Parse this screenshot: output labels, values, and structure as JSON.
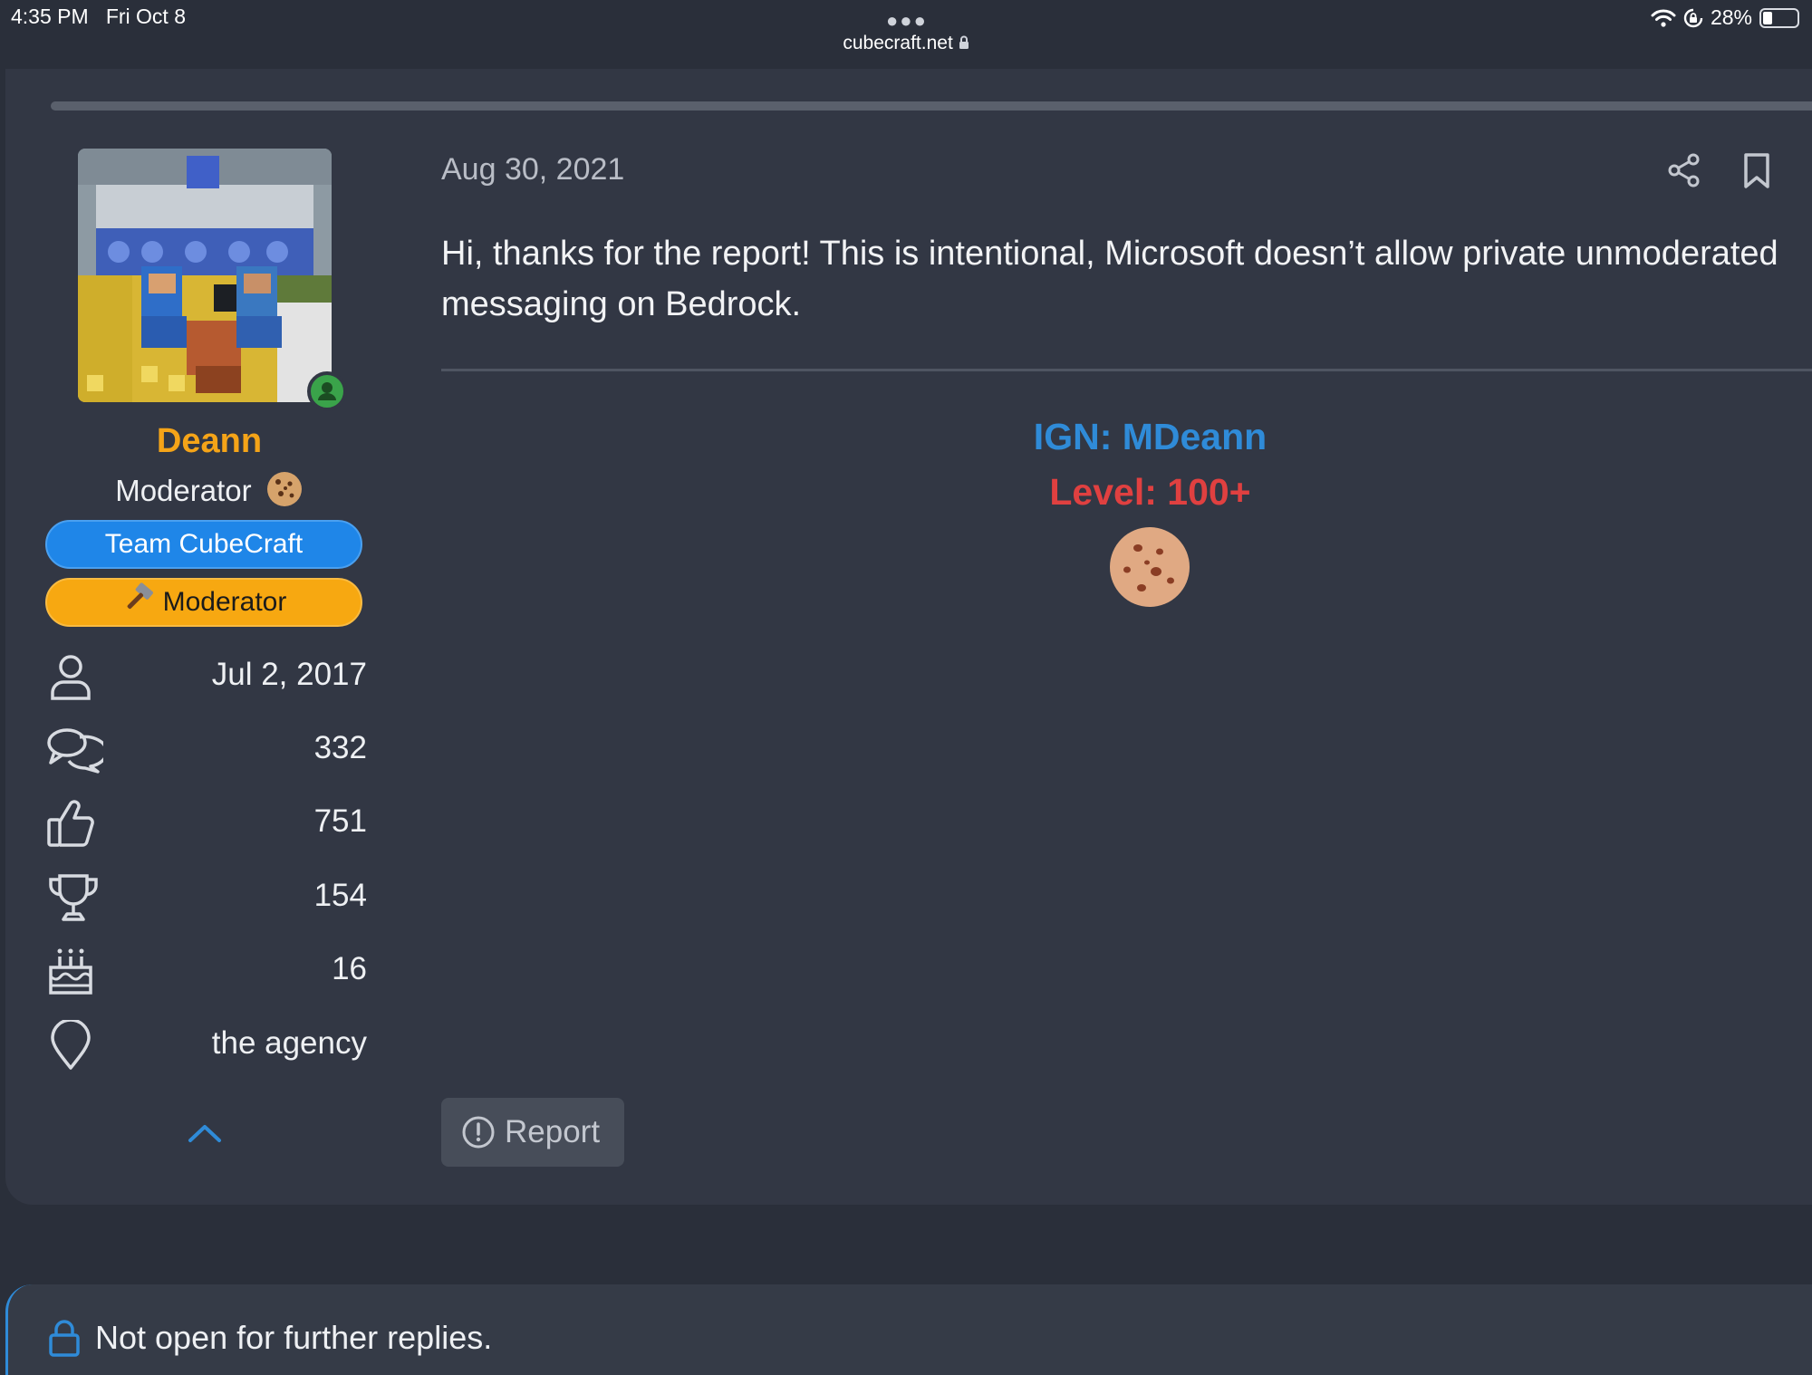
{
  "status_bar": {
    "time": "4:35 PM",
    "date": "Fri Oct 8",
    "url": "cubecraft.net",
    "battery_text": "28%",
    "battery_level": 0.28
  },
  "author": {
    "name": "Deann",
    "title": "Moderator",
    "banners": {
      "team": "Team CubeCraft",
      "moderator": "Moderator"
    },
    "stats": {
      "joined": "Jul 2, 2017",
      "messages": "332",
      "reactions": "751",
      "points": "154",
      "age": "16",
      "location": "the agency"
    }
  },
  "post": {
    "date": "Aug 30, 2021",
    "body": "Hi, thanks for the report! This is intentional, Microsoft doesn’t allow private unmoderated messaging on Bedrock.",
    "signature": {
      "ign": "IGN: MDeann",
      "level": "Level: 100+"
    },
    "report_label": "Report"
  },
  "thread_notice": "Not open for further replies.",
  "colors": {
    "username": "#f5a418",
    "team_banner": "#1f86e8",
    "mod_banner": "#f7a811",
    "ign": "#2f8bd8",
    "level": "#e04040",
    "online": "#3aa34a"
  },
  "icons": [
    "more-dots-icon",
    "lock-icon",
    "wifi-icon",
    "rotation-lock-icon",
    "battery-icon",
    "online-icon",
    "cookie-icon",
    "hammer-icon",
    "user-icon",
    "messages-icon",
    "thumbs-up-icon",
    "trophy-icon",
    "cake-icon",
    "location-pin-icon",
    "chevron-up-icon",
    "share-icon",
    "bookmark-icon",
    "report-icon"
  ]
}
